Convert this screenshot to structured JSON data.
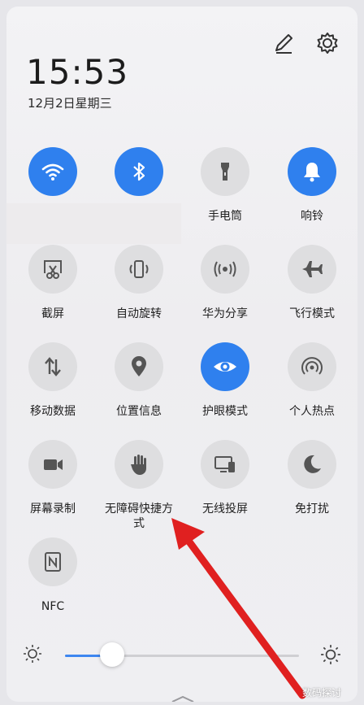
{
  "clock": {
    "time": "15:53",
    "date": "12月2日星期三"
  },
  "top_actions": [
    "edit-icon",
    "settings-icon"
  ],
  "tiles": [
    {
      "label": "",
      "icon": "wifi-icon",
      "on": true
    },
    {
      "label": "",
      "icon": "bluetooth-icon",
      "on": true
    },
    {
      "label": "手电筒",
      "icon": "flashlight-icon",
      "on": false
    },
    {
      "label": "响铃",
      "icon": "bell-icon",
      "on": true
    },
    {
      "label": "截屏",
      "icon": "screenshot-icon",
      "on": false
    },
    {
      "label": "自动旋转",
      "icon": "rotate-icon",
      "on": false
    },
    {
      "label": "华为分享",
      "icon": "share-icon",
      "on": false
    },
    {
      "label": "飞行模式",
      "icon": "airplane-icon",
      "on": false
    },
    {
      "label": "移动数据",
      "icon": "mobile-data-icon",
      "on": false
    },
    {
      "label": "位置信息",
      "icon": "location-icon",
      "on": false
    },
    {
      "label": "护眼模式",
      "icon": "eye-icon",
      "on": true
    },
    {
      "label": "个人热点",
      "icon": "hotspot-icon",
      "on": false
    },
    {
      "label": "屏幕录制",
      "icon": "video-camera-icon",
      "on": false
    },
    {
      "label": "无障碍快捷方式",
      "label_line1": "无障碍快捷方",
      "label_line2": "式",
      "icon": "hand-icon",
      "on": false
    },
    {
      "label": "无线投屏",
      "icon": "cast-screen-icon",
      "on": false
    },
    {
      "label": "免打扰",
      "icon": "moon-icon",
      "on": false
    },
    {
      "label": "NFC",
      "icon": "nfc-icon",
      "on": false
    }
  ],
  "brightness": {
    "level": 0.2
  },
  "watermark": "数码探讨",
  "colors": {
    "accent": "#2f80ee",
    "annotation_arrow": "#e02020"
  }
}
